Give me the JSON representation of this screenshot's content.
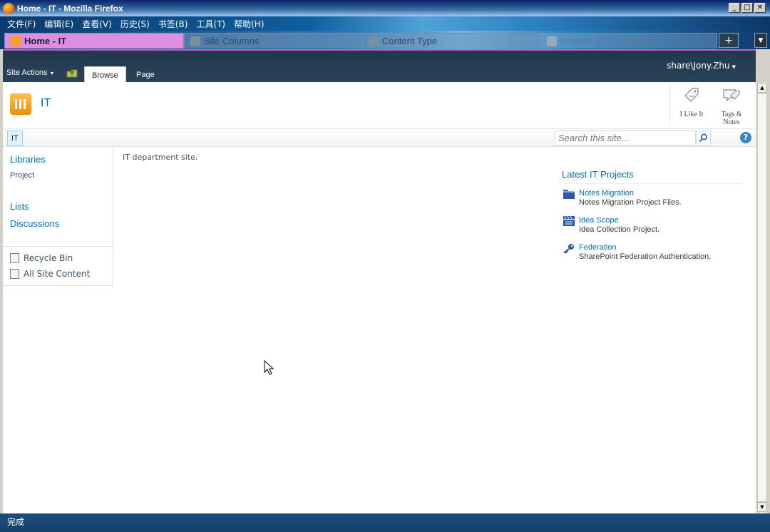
{
  "window": {
    "title": "Home - IT - Mozilla Firefox"
  },
  "menubar": {
    "items": [
      "文件(F)",
      "编辑(E)",
      "查看(V)",
      "历史(S)",
      "书签(B)",
      "工具(T)",
      "帮助(H)"
    ]
  },
  "browser_tabs": [
    {
      "label": "Home - IT"
    },
    {
      "label": "Site Columns"
    },
    {
      "label": "Content Type"
    },
    {
      "label": "Project - All Documents"
    }
  ],
  "newtab_label": "+",
  "ribbon": {
    "site_actions": "Site Actions",
    "tabs": {
      "browse": "Browse",
      "page": "Page"
    },
    "user": "share\\Jony.Zhu"
  },
  "site": {
    "title": "IT",
    "social": {
      "like": "I Like It",
      "tags_line1": "Tags &",
      "tags_line2": "Notes"
    },
    "topnav_item": "IT",
    "search_placeholder": "Search this site...",
    "help": "?"
  },
  "quicklaunch": {
    "libraries": "Libraries",
    "project": "Project",
    "lists": "Lists",
    "discussions": "Discussions",
    "recycle_bin": "Recycle Bin",
    "all_site_content": "All Site Content"
  },
  "main": {
    "description": "IT department site.",
    "projects_title": "Latest IT Projects",
    "projects": [
      {
        "name": "Notes Migration",
        "desc": "Notes Migration Project Files.",
        "icon": "folder-icon"
      },
      {
        "name": "Idea Scope",
        "desc": "Idea Collection Project.",
        "icon": "clapper-icon"
      },
      {
        "name": "Federation",
        "desc": "SharePoint Federation Authentication.",
        "icon": "key-icon"
      }
    ]
  },
  "statusbar": {
    "text": "完成"
  },
  "colors": {
    "accent": "#0072bc",
    "ribbon": "#21374c",
    "active_tab": "#dc8fe0"
  }
}
